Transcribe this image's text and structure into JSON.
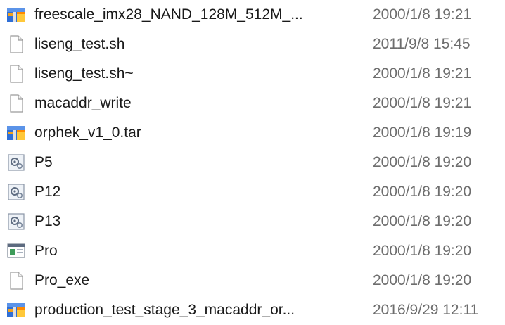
{
  "files": [
    {
      "name": "freescale_imx28_NAND_128M_512M_...",
      "modified": "2000/1/8 19:21",
      "icon": "archive-icon"
    },
    {
      "name": "liseng_test.sh",
      "modified": "2011/9/8 15:45",
      "icon": "file-icon"
    },
    {
      "name": "liseng_test.sh~",
      "modified": "2000/1/8 19:21",
      "icon": "file-icon"
    },
    {
      "name": "macaddr_write",
      "modified": "2000/1/8 19:21",
      "icon": "file-icon"
    },
    {
      "name": "orphek_v1_0.tar",
      "modified": "2000/1/8 19:19",
      "icon": "archive-icon"
    },
    {
      "name": "P5",
      "modified": "2000/1/8 19:20",
      "icon": "settings-file-icon"
    },
    {
      "name": "P12",
      "modified": "2000/1/8 19:20",
      "icon": "settings-file-icon"
    },
    {
      "name": "P13",
      "modified": "2000/1/8 19:20",
      "icon": "settings-file-icon"
    },
    {
      "name": "Pro",
      "modified": "2000/1/8 19:20",
      "icon": "application-icon"
    },
    {
      "name": "Pro_exe",
      "modified": "2000/1/8 19:20",
      "icon": "file-icon"
    },
    {
      "name": "production_test_stage_3_macaddr_or...",
      "modified": "2016/9/29 12:11",
      "icon": "archive-icon"
    }
  ],
  "colors": {
    "text": "#1a1a1a",
    "date_text": "#6d6d6d",
    "archive_blue": "#2f6fd6",
    "archive_orange": "#f3a21c"
  }
}
